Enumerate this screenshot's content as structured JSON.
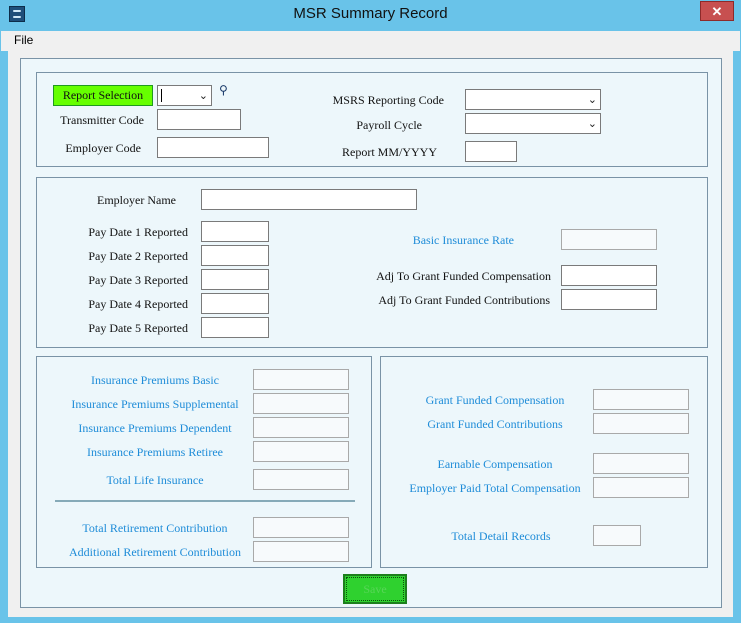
{
  "window": {
    "title": "MSR Summary Record",
    "close_glyph": "✕"
  },
  "menu": {
    "file": "File"
  },
  "header_group": {
    "report_selection_button": "Report Selection",
    "report_selection_value": "",
    "search_icon": "magnifier-icon",
    "transmitter_code_label": "Transmitter Code",
    "transmitter_code_value": "",
    "employer_code_label": "Employer Code",
    "employer_code_value": "",
    "msrs_reporting_code_label": "MSRS Reporting Code",
    "msrs_reporting_code_value": "",
    "payroll_cycle_label": "Payroll Cycle",
    "payroll_cycle_value": "",
    "report_period_label": "Report MM/YYYY",
    "report_period_value": ""
  },
  "employer_group": {
    "employer_name_label": "Employer Name",
    "employer_name_value": "",
    "pay_dates": [
      {
        "label": "Pay Date 1 Reported",
        "value": ""
      },
      {
        "label": "Pay Date 2 Reported",
        "value": ""
      },
      {
        "label": "Pay Date 3 Reported",
        "value": ""
      },
      {
        "label": "Pay Date 4 Reported",
        "value": ""
      },
      {
        "label": "Pay Date 5 Reported",
        "value": ""
      }
    ],
    "basic_insurance_rate_label": "Basic Insurance Rate",
    "basic_insurance_rate_value": "",
    "adj_grant_comp_label": "Adj To Grant Funded Compensation",
    "adj_grant_comp_value": "",
    "adj_grant_contrib_label": "Adj To Grant Funded Contributions",
    "adj_grant_contrib_value": ""
  },
  "insurance_group": {
    "premiums_basic_label": "Insurance Premiums Basic",
    "premiums_supplemental_label": "Insurance Premiums Supplemental",
    "premiums_dependent_label": "Insurance Premiums Dependent",
    "premiums_retiree_label": "Insurance Premiums Retiree",
    "total_life_label": "Total Life Insurance",
    "total_retirement_label": "Total Retirement Contribution",
    "additional_retirement_label": "Additional Retirement Contribution"
  },
  "totals_group": {
    "grant_comp_label": "Grant Funded Compensation",
    "grant_contrib_label": "Grant Funded Contributions",
    "earnable_comp_label": "Earnable Compensation",
    "employer_paid_total_label": "Employer Paid Total Compensation",
    "total_detail_records_label": "Total Detail Records"
  },
  "footer": {
    "save_label": "Save"
  },
  "colors": {
    "title_bar": "#69c3e9",
    "accent_blue_label": "#1e8cd8",
    "green_button": "#66ff00",
    "close_button": "#c75050"
  }
}
